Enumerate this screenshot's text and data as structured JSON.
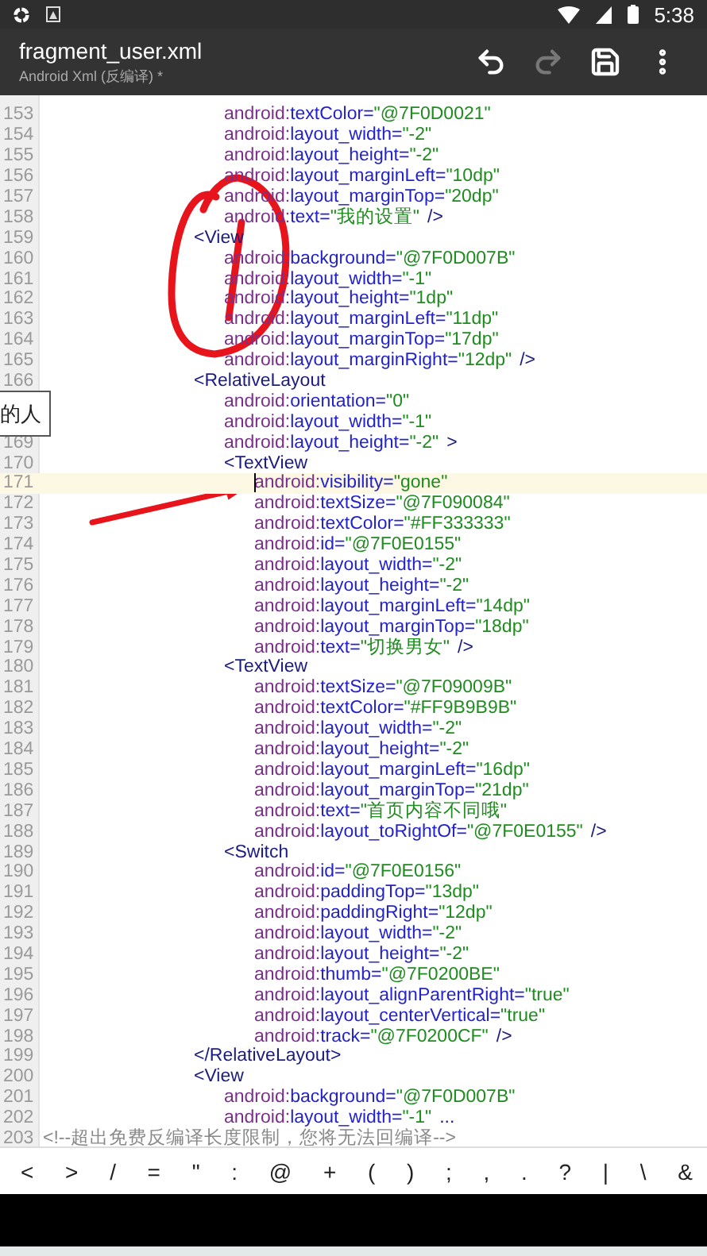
{
  "status_bar": {
    "time": "5:38"
  },
  "toolbar": {
    "title": "fragment_user.xml",
    "subtitle": "Android Xml (反编译) *",
    "actions": [
      {
        "kind": "undo",
        "disabled": false
      },
      {
        "kind": "redo",
        "disabled": true
      },
      {
        "kind": "save",
        "disabled": false
      },
      {
        "kind": "more",
        "disabled": false
      }
    ]
  },
  "code": [
    {
      "children": [
        {
          "children": [
            {
              "children": [
                {
                  "children": [
                    {
                      "children": [
                        {
                          "children": [
                            {
                              "number": "153",
                              "current": false,
                              "ns": "android:",
                              "name": "textColor=",
                              "value": "\"@7F0D0021\""
                            },
                            {
                              "number": "154",
                              "current": false,
                              "ns": "android:",
                              "name": "layout_width=",
                              "value": "\"-2\""
                            },
                            {
                              "number": "155",
                              "current": false,
                              "ns": "android:",
                              "name": "layout_height=",
                              "value": "\"-2\""
                            },
                            {
                              "number": "156",
                              "current": false,
                              "ns": "android:",
                              "name": "layout_marginLeft=",
                              "value": "\"10dp\""
                            },
                            {
                              "number": "157",
                              "current": false,
                              "ns": "android:",
                              "name": "layout_marginTop=",
                              "value": "\"20dp\""
                            },
                            {
                              "number": "158",
                              "current": false,
                              "ns": "android:",
                              "name": "text=",
                              "value": "\"我的设置\"",
                              "end": "/>"
                            }
                          ]
                        },
                        {
                          "number": "159",
                          "current": false,
                          "tag": "<View",
                          "children": [
                            {
                              "number": "160",
                              "current": false,
                              "ns": "android:",
                              "name": "background=",
                              "value": "\"@7F0D007B\""
                            },
                            {
                              "number": "161",
                              "current": false,
                              "ns": "android:",
                              "name": "layout_width=",
                              "value": "\"-1\""
                            },
                            {
                              "number": "162",
                              "current": false,
                              "ns": "android:",
                              "name": "layout_height=",
                              "value": "\"1dp\""
                            },
                            {
                              "number": "163",
                              "current": false,
                              "ns": "android:",
                              "name": "layout_marginLeft=",
                              "value": "\"11dp\""
                            },
                            {
                              "number": "164",
                              "current": false,
                              "ns": "android:",
                              "name": "layout_marginTop=",
                              "value": "\"17dp\""
                            },
                            {
                              "number": "165",
                              "current": false,
                              "ns": "android:",
                              "name": "layout_marginRight=",
                              "value": "\"12dp\"",
                              "end": "/>"
                            }
                          ]
                        },
                        {
                          "number": "166",
                          "current": false,
                          "tag": "<RelativeLayout",
                          "children": [
                            {
                              "current": false,
                              "ns": "android:",
                              "name": "orientation=",
                              "value": "\"0\""
                            },
                            {
                              "current": false,
                              "ns": "android:",
                              "name": "layout_width=",
                              "value": "\"-1\""
                            },
                            {
                              "number": "169",
                              "current": false,
                              "ns": "android:",
                              "name": "layout_height=",
                              "value": "\"-2\"",
                              "end": ">"
                            },
                            {
                              "number": "170",
                              "current": false,
                              "tag": "<TextView",
                              "children": [
                                {
                                  "number": "171",
                                  "current": true,
                                  "ns": "android:",
                                  "name": "visibility=",
                                  "value": "\"gone\""
                                },
                                {
                                  "number": "172",
                                  "current": false,
                                  "ns": "android:",
                                  "name": "textSize=",
                                  "value": "\"@7F090084\""
                                },
                                {
                                  "number": "173",
                                  "current": false,
                                  "ns": "android:",
                                  "name": "textColor=",
                                  "value": "\"#FF333333\""
                                },
                                {
                                  "number": "174",
                                  "current": false,
                                  "ns": "android:",
                                  "name": "id=",
                                  "value": "\"@7F0E0155\""
                                },
                                {
                                  "number": "175",
                                  "current": false,
                                  "ns": "android:",
                                  "name": "layout_width=",
                                  "value": "\"-2\""
                                },
                                {
                                  "number": "176",
                                  "current": false,
                                  "ns": "android:",
                                  "name": "layout_height=",
                                  "value": "\"-2\""
                                },
                                {
                                  "number": "177",
                                  "current": false,
                                  "ns": "android:",
                                  "name": "layout_marginLeft=",
                                  "value": "\"14dp\""
                                },
                                {
                                  "number": "178",
                                  "current": false,
                                  "ns": "android:",
                                  "name": "layout_marginTop=",
                                  "value": "\"18dp\""
                                },
                                {
                                  "number": "179",
                                  "current": false,
                                  "ns": "android:",
                                  "name": "text=",
                                  "value": "\"切换男女\"",
                                  "end": "/>"
                                }
                              ]
                            },
                            {
                              "number": "180",
                              "current": false,
                              "tag": "<TextView",
                              "children": [
                                {
                                  "number": "181",
                                  "current": false,
                                  "ns": "android:",
                                  "name": "textSize=",
                                  "value": "\"@7F09009B\""
                                },
                                {
                                  "number": "182",
                                  "current": false,
                                  "ns": "android:",
                                  "name": "textColor=",
                                  "value": "\"#FF9B9B9B\""
                                },
                                {
                                  "number": "183",
                                  "current": false,
                                  "ns": "android:",
                                  "name": "layout_width=",
                                  "value": "\"-2\""
                                },
                                {
                                  "number": "184",
                                  "current": false,
                                  "ns": "android:",
                                  "name": "layout_height=",
                                  "value": "\"-2\""
                                },
                                {
                                  "number": "185",
                                  "current": false,
                                  "ns": "android:",
                                  "name": "layout_marginLeft=",
                                  "value": "\"16dp\""
                                },
                                {
                                  "number": "186",
                                  "current": false,
                                  "ns": "android:",
                                  "name": "layout_marginTop=",
                                  "value": "\"21dp\""
                                },
                                {
                                  "number": "187",
                                  "current": false,
                                  "ns": "android:",
                                  "name": "text=",
                                  "value": "\"首页内容不同哦\""
                                },
                                {
                                  "number": "188",
                                  "current": false,
                                  "ns": "android:",
                                  "name": "layout_toRightOf=",
                                  "value": "\"@7F0E0155\"",
                                  "end": "/>"
                                }
                              ]
                            },
                            {
                              "number": "189",
                              "current": false,
                              "tag": "<Switch",
                              "children": [
                                {
                                  "number": "190",
                                  "current": false,
                                  "ns": "android:",
                                  "name": "id=",
                                  "value": "\"@7F0E0156\""
                                },
                                {
                                  "number": "191",
                                  "current": false,
                                  "ns": "android:",
                                  "name": "paddingTop=",
                                  "value": "\"13dp\""
                                },
                                {
                                  "number": "192",
                                  "current": false,
                                  "ns": "android:",
                                  "name": "paddingRight=",
                                  "value": "\"12dp\""
                                },
                                {
                                  "number": "193",
                                  "current": false,
                                  "ns": "android:",
                                  "name": "layout_width=",
                                  "value": "\"-2\""
                                },
                                {
                                  "number": "194",
                                  "current": false,
                                  "ns": "android:",
                                  "name": "layout_height=",
                                  "value": "\"-2\""
                                },
                                {
                                  "number": "195",
                                  "current": false,
                                  "ns": "android:",
                                  "name": "thumb=",
                                  "value": "\"@7F0200BE\""
                                },
                                {
                                  "number": "196",
                                  "current": false,
                                  "ns": "android:",
                                  "name": "layout_alignParentRight=",
                                  "value": "\"true\""
                                },
                                {
                                  "number": "197",
                                  "current": false,
                                  "ns": "android:",
                                  "name": "layout_centerVertical=",
                                  "value": "\"true\""
                                },
                                {
                                  "number": "198",
                                  "current": false,
                                  "ns": "android:",
                                  "name": "track=",
                                  "value": "\"@7F0200CF\"",
                                  "end": "/>"
                                }
                              ]
                            }
                          ]
                        },
                        {
                          "number": "199",
                          "current": false,
                          "tag": "</RelativeLayout>"
                        },
                        {
                          "number": "200",
                          "current": false,
                          "tag": "<View",
                          "children": [
                            {
                              "number": "201",
                              "current": false,
                              "ns": "android:",
                              "name": "background=",
                              "value": "\"@7F0D007B\""
                            },
                            {
                              "number": "202",
                              "current": false,
                              "ns": "android:",
                              "name": "layout_width=",
                              "value": "\"-1\"",
                              "end": "..."
                            }
                          ]
                        }
                      ]
                    }
                  ]
                }
              ]
            }
          ]
        }
      ]
    },
    {
      "number": "203",
      "current": false,
      "comment": "<!--超出免费反编译长度限制，您将无法回编译-->"
    }
  ],
  "popup": {
    "text": "的人"
  },
  "symbols": [
    "<",
    ">",
    "/",
    "=",
    "\"",
    ":",
    "@",
    "+",
    "(",
    ")",
    ";",
    ",",
    ".",
    "?",
    "|",
    "\\",
    "&"
  ]
}
